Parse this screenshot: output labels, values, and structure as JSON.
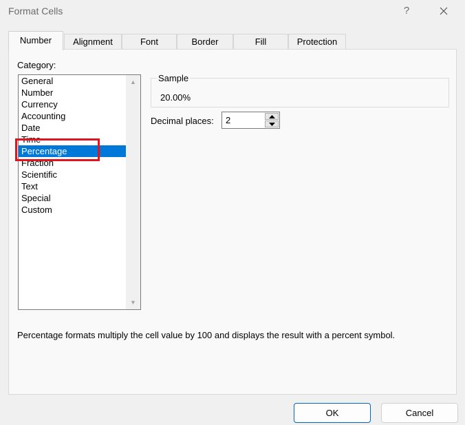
{
  "window": {
    "title": "Format Cells",
    "help_label": "?",
    "close_icon": "close-icon"
  },
  "tabs": [
    {
      "label": "Number",
      "active": true
    },
    {
      "label": "Alignment",
      "active": false
    },
    {
      "label": "Font",
      "active": false
    },
    {
      "label": "Border",
      "active": false
    },
    {
      "label": "Fill",
      "active": false
    },
    {
      "label": "Protection",
      "active": false
    }
  ],
  "category": {
    "label": "Category:",
    "items": [
      "General",
      "Number",
      "Currency",
      "Accounting",
      "Date",
      "Time",
      "Percentage",
      "Fraction",
      "Scientific",
      "Text",
      "Special",
      "Custom"
    ],
    "selected": "Percentage"
  },
  "sample": {
    "label": "Sample",
    "value": "20.00%"
  },
  "decimal_places": {
    "label": "Decimal places:",
    "value": "2"
  },
  "description": "Percentage formats multiply the cell value by 100 and displays the result with a percent symbol.",
  "buttons": {
    "ok": "OK",
    "cancel": "Cancel"
  },
  "colors": {
    "selection": "#0078d7",
    "highlight_annotation": "#e0141e",
    "ok_border": "#0067c0"
  }
}
